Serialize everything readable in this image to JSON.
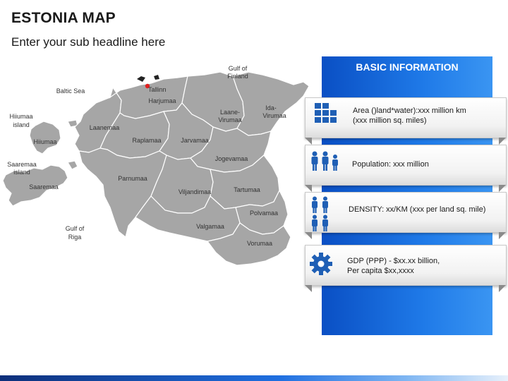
{
  "title": "ESTONIA MAP",
  "subtitle": "Enter your sub headline here",
  "map": {
    "capital": "Tallinn",
    "water_labels": {
      "gulf_finland": [
        "Gulf of",
        "Finland"
      ],
      "baltic_sea": "Baltic Sea",
      "gulf_riga": [
        "Gulf of",
        "Riga"
      ],
      "hiiumaa_island": [
        "Hiiumaa",
        "island"
      ],
      "saaremaa_island": [
        "Saaremaa",
        "island"
      ]
    },
    "regions": {
      "harjumaa": [
        "Harjumaa"
      ],
      "laane_virumaa": [
        "Laane-",
        "Virumaa"
      ],
      "ida_virumaa": [
        "Ida-",
        "Virumaa"
      ],
      "laanemaa": [
        "Laanemaa"
      ],
      "raplamaa": [
        "Raplamaa"
      ],
      "jarvamaa": [
        "Jarvamaa"
      ],
      "jogevamaa": [
        "Jogevamaa"
      ],
      "hiiumaa": [
        "Hiiumaa"
      ],
      "saaremaa": [
        "Saaremaa"
      ],
      "parnumaa": [
        "Parnumaa"
      ],
      "viljandimaa": [
        "Viljandimaa"
      ],
      "tartumaa": [
        "Tartumaa"
      ],
      "polvamaa": [
        "Polvamaa"
      ],
      "valgamaa": [
        "Valgamaa"
      ],
      "vorumaa": [
        "Vorumaa"
      ]
    },
    "colors": {
      "land": "#a6a6a6",
      "border": "#ffffff",
      "capital_dot": "#e02020"
    }
  },
  "panel": {
    "title": "BASIC INFORMATION",
    "items": [
      {
        "icon": "area-grid-icon",
        "lines": [
          "Area ()land*water):xxx million km",
          "(xxx million sq. miles)"
        ]
      },
      {
        "icon": "population-icon",
        "lines": [
          "Population: xxx million"
        ]
      },
      {
        "icon": "density-icon",
        "lines": [
          "DENSITY: xx/KM (xxx per land sq. mile)"
        ]
      },
      {
        "icon": "gear-icon",
        "lines": [
          "GDP (PPP) - $xx.xx billion,",
          "Per capita $xx,xxxx"
        ]
      }
    ],
    "colors": {
      "accent": "#1565d8",
      "icon": "#1f5fb5"
    }
  }
}
